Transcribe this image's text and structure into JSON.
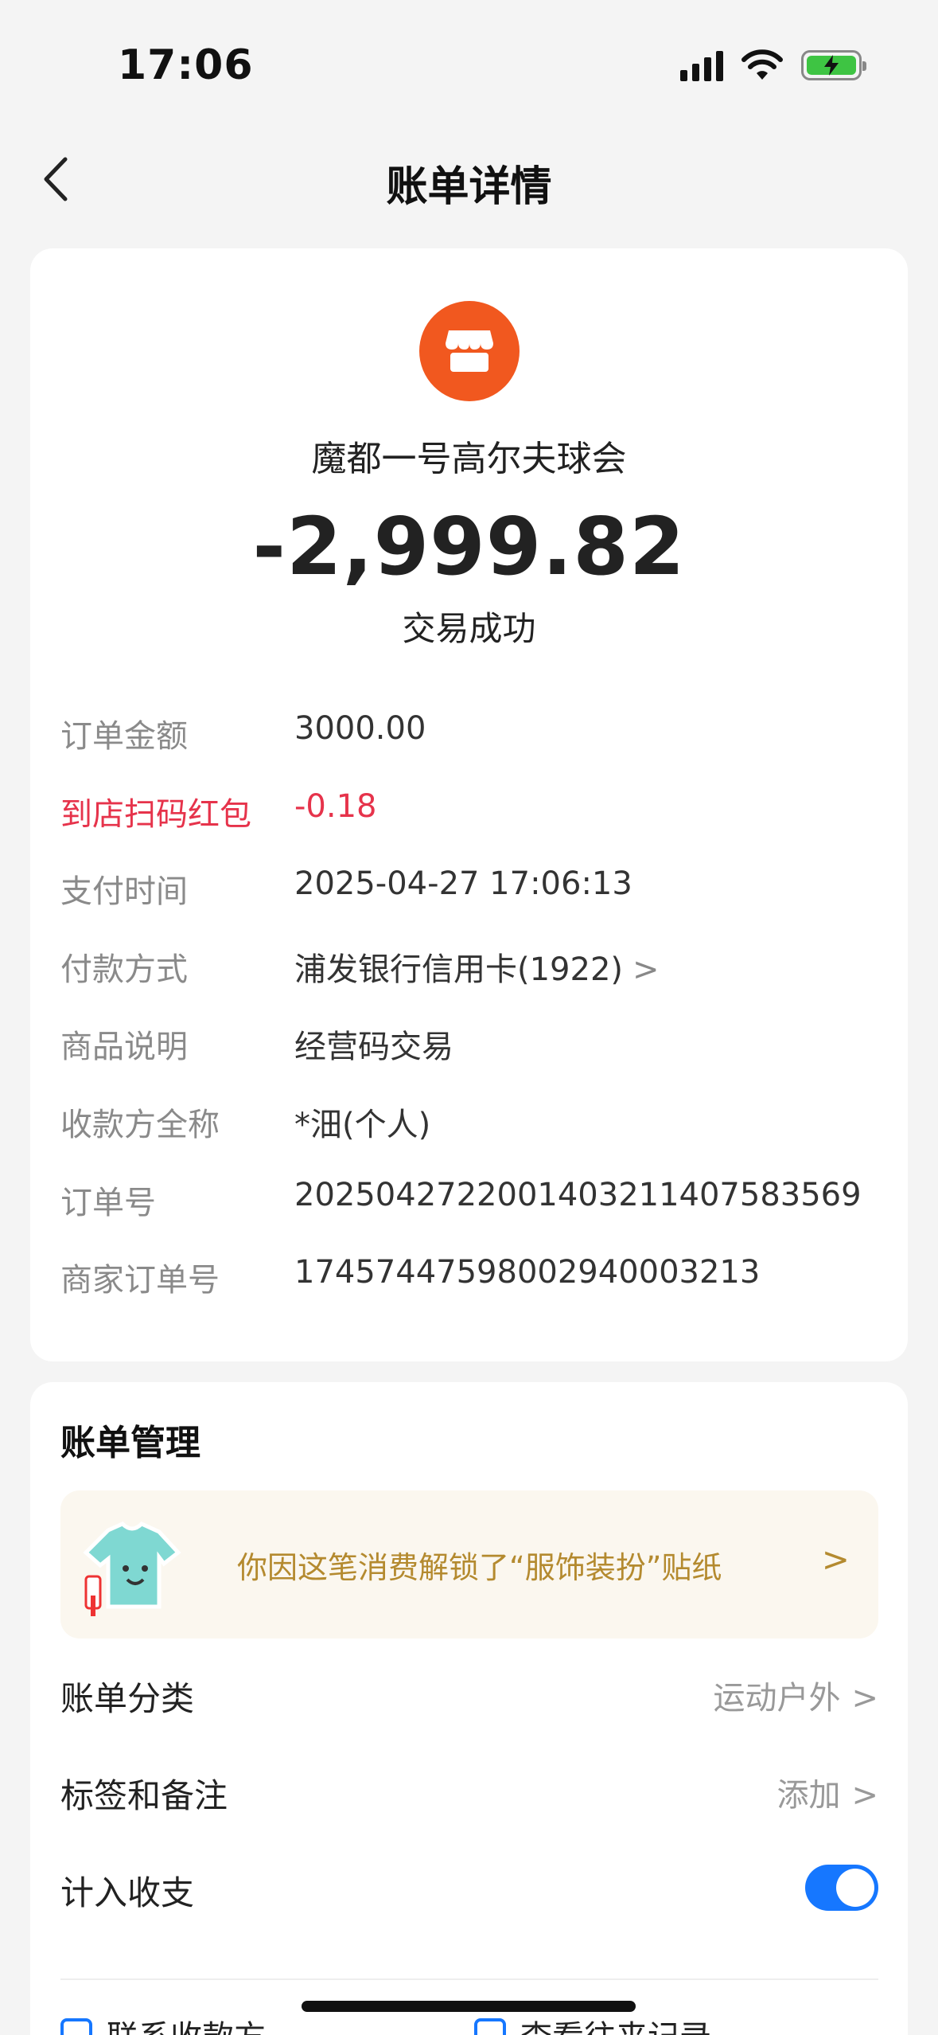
{
  "status_bar": {
    "time": "17:06"
  },
  "nav": {
    "title": "账单详情"
  },
  "transaction": {
    "merchant": "魔都一号高尔夫球会",
    "amount": "-2,999.82",
    "status": "交易成功",
    "brand_color": "#f1581f"
  },
  "details": [
    {
      "label": "订单金额",
      "value": "3000.00"
    },
    {
      "label": "到店扫码红包",
      "value": "-0.18",
      "highlight_color": "#e6334b"
    },
    {
      "label": "支付时间",
      "value": "2025-04-27 17:06:13"
    },
    {
      "label": "付款方式",
      "value": "浦发银行信用卡(1922)",
      "chevron": ">"
    },
    {
      "label": "商品说明",
      "value": "经营码交易"
    },
    {
      "label": "收款方全称",
      "value": "*沺(个人)"
    },
    {
      "label": "订单号",
      "value": "2025042722001403211407583569"
    },
    {
      "label": "商家订单号",
      "value": "17457447598002940003213"
    }
  ],
  "manage": {
    "title": "账单管理",
    "sticker_banner": {
      "text": "你因这笔消费解锁了“服饰装扮”贴纸",
      "chevron": ">"
    },
    "category": {
      "label": "账单分类",
      "value": "运动户外",
      "chevron": ">"
    },
    "tags": {
      "label": "标签和备注",
      "value": "添加",
      "chevron": ">"
    },
    "include_in_budget": {
      "label": "计入收支",
      "enabled": true
    },
    "links": [
      "联系收款方",
      "查看往来记录"
    ],
    "accent_color": "#1677ff"
  }
}
